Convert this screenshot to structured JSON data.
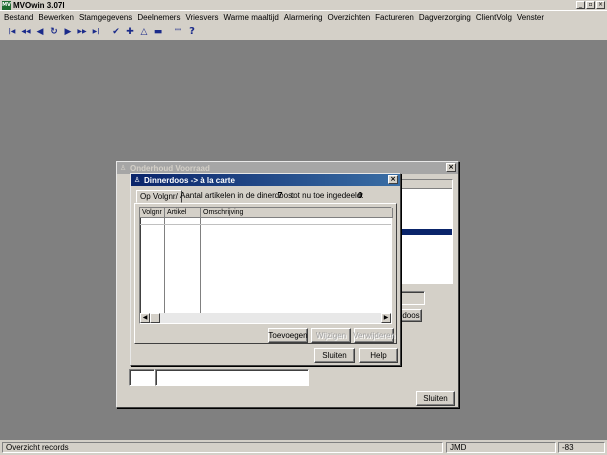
{
  "app": {
    "title": "MVOwin 3.07l",
    "icon_text": "MV"
  },
  "window_controls": {
    "minimize": "_",
    "restore": "▫",
    "close": "×"
  },
  "menu": [
    "Bestand",
    "Bewerken",
    "Stamgegevens",
    "Deelnemers",
    "Vriesvers",
    "Warme maaltijd",
    "Alarmering",
    "Overzichten",
    "Factureren",
    "Dagverzorging",
    "ClientVolg",
    "Venster"
  ],
  "toolbar": [
    {
      "name": "first-record-icon",
      "glyph": "|◀"
    },
    {
      "name": "prev-page-icon",
      "glyph": "◀◀"
    },
    {
      "name": "prev-record-icon",
      "glyph": "◀"
    },
    {
      "name": "refresh-icon",
      "glyph": "↻"
    },
    {
      "name": "next-record-icon",
      "glyph": "▶"
    },
    {
      "name": "next-page-icon",
      "glyph": "▶▶"
    },
    {
      "name": "last-record-icon",
      "glyph": "▶|"
    },
    {
      "name": "check-icon",
      "glyph": "✔"
    },
    {
      "name": "add-icon",
      "glyph": "✚"
    },
    {
      "name": "edit-icon",
      "glyph": "△"
    },
    {
      "name": "delete-icon",
      "glyph": "▬"
    },
    {
      "name": "quote-icon",
      "glyph": "\"\""
    },
    {
      "name": "help-icon",
      "glyph": "?"
    }
  ],
  "onderhoud": {
    "title": "Onderhoud Voorraad",
    "doos_button": "doos",
    "sluiten_button": "Sluiten"
  },
  "dinnerdoos": {
    "title": "Dinnerdoos -> à la carte",
    "tab": "Op Volgnr/",
    "count_label": "Aantal artikelen in de dinerdoos:",
    "count_value": "7",
    "assigned_label": "tot nu toe ingedeeld:",
    "assigned_value": "0",
    "columns": [
      "Volgnr",
      "Artikel",
      "Omschrijving"
    ],
    "buttons": {
      "toevoegen": "Toevoegen",
      "wijzigen": "Wijzigen",
      "verwijderen": "Verwijderen",
      "sluiten": "Sluiten",
      "help": "Help"
    }
  },
  "statusbar": {
    "left": "Overzicht records",
    "user": "JMD",
    "code": "-83"
  }
}
